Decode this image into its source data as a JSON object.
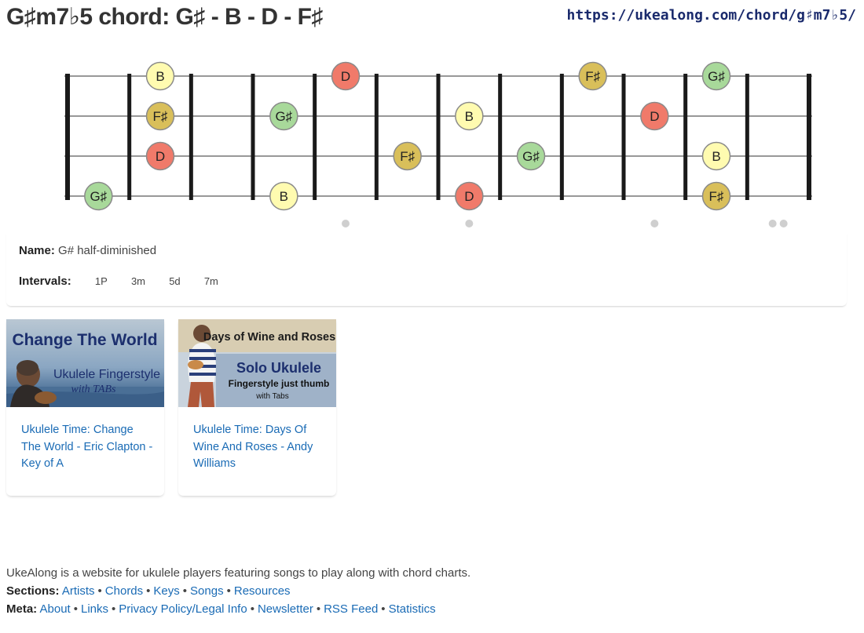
{
  "header": {
    "title": "G♯m7♭5 chord: G♯ - B - D - F♯",
    "url": "https://ukealong.com/chord/g♯m7♭5/"
  },
  "fretboard": {
    "strings": 4,
    "frets": 12,
    "inlay_frets": [
      5,
      7,
      10,
      12
    ],
    "double_inlay_fret": 12,
    "note_colors": {
      "G♯": "#a8d99a",
      "B": "#fffbb0",
      "D": "#f07a6a",
      "F♯": "#d9bf5a"
    },
    "notes": [
      {
        "string": 1,
        "fret": 2,
        "label": "B"
      },
      {
        "string": 1,
        "fret": 5,
        "label": "D"
      },
      {
        "string": 1,
        "fret": 9,
        "label": "F♯"
      },
      {
        "string": 1,
        "fret": 11,
        "label": "G♯"
      },
      {
        "string": 2,
        "fret": 2,
        "label": "F♯"
      },
      {
        "string": 2,
        "fret": 4,
        "label": "G♯"
      },
      {
        "string": 2,
        "fret": 7,
        "label": "B"
      },
      {
        "string": 2,
        "fret": 10,
        "label": "D"
      },
      {
        "string": 3,
        "fret": 2,
        "label": "D"
      },
      {
        "string": 3,
        "fret": 6,
        "label": "F♯"
      },
      {
        "string": 3,
        "fret": 8,
        "label": "G♯"
      },
      {
        "string": 3,
        "fret": 11,
        "label": "B"
      },
      {
        "string": 4,
        "fret": 1,
        "label": "G♯"
      },
      {
        "string": 4,
        "fret": 4,
        "label": "B"
      },
      {
        "string": 4,
        "fret": 7,
        "label": "D"
      },
      {
        "string": 4,
        "fret": 11,
        "label": "F♯"
      }
    ]
  },
  "info": {
    "name_label": "Name:",
    "name_value": "G# half-diminished",
    "intervals_label": "Intervals:",
    "intervals": [
      "1P",
      "3m",
      "5d",
      "7m"
    ]
  },
  "videos": [
    {
      "link": "Ukulele Time: Change The World - Eric Clapton - Key of A",
      "thumb_title": "Change The World",
      "thumb_line1": "Ukulele Fingerstyle",
      "thumb_line2": "with TABs"
    },
    {
      "link": "Ukulele Time: Days Of Wine And Roses - Andy Williams",
      "thumb_title": "Days of Wine and Roses",
      "thumb_line1": "Solo Ukulele",
      "thumb_line2": "Fingerstyle just thumb",
      "thumb_line3": "with Tabs"
    }
  ],
  "footer": {
    "tagline": "UkeAlong is a website for ukulele players featuring songs to play along with chord charts.",
    "sections_label": "Sections:",
    "sections": [
      "Artists",
      "Chords",
      "Keys",
      "Songs",
      "Resources"
    ],
    "meta_label": "Meta:",
    "meta": [
      "About",
      "Links",
      "Privacy Policy/Legal Info",
      "Newsletter",
      "RSS Feed",
      "Statistics"
    ]
  }
}
